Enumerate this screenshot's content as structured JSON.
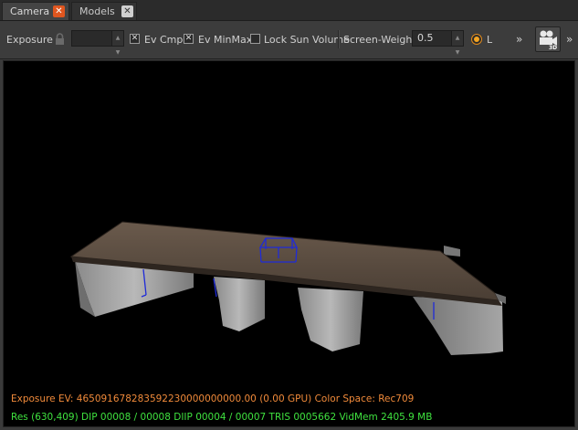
{
  "tabs": [
    {
      "label": "Camera",
      "active": true
    },
    {
      "label": "Models",
      "active": false
    }
  ],
  "toolbar": {
    "exposure_label": "Exposure",
    "exposure_value": "",
    "ev_cmp_label": "Ev Cmp",
    "ev_cmp_checked": true,
    "ev_minmax_label": "Ev MinMax",
    "ev_minmax_checked": true,
    "lock_sun_label": "Lock Sun Volume",
    "lock_sun_checked": false,
    "screen_weight_label": "Screen-Weight",
    "screen_weight_value": "0.5",
    "l_label": "L",
    "camera_3d_badge": "3D"
  },
  "hud": {
    "exposure_line": "Exposure EV: 465091678283592230000000000.00 (0.00 GPU)  Color Space: Rec709",
    "stats_line": "Res (630,409)   DIP 00008 / 00008  DIIP 00004 / 00007  TRIS 0005662  VidMem 2405.9 MB"
  },
  "colors": {
    "accent": "#e0561f",
    "hud_orange": "#f08a3a",
    "hud_green": "#3fe23f",
    "gizmo_blue": "#1f2bd8"
  }
}
